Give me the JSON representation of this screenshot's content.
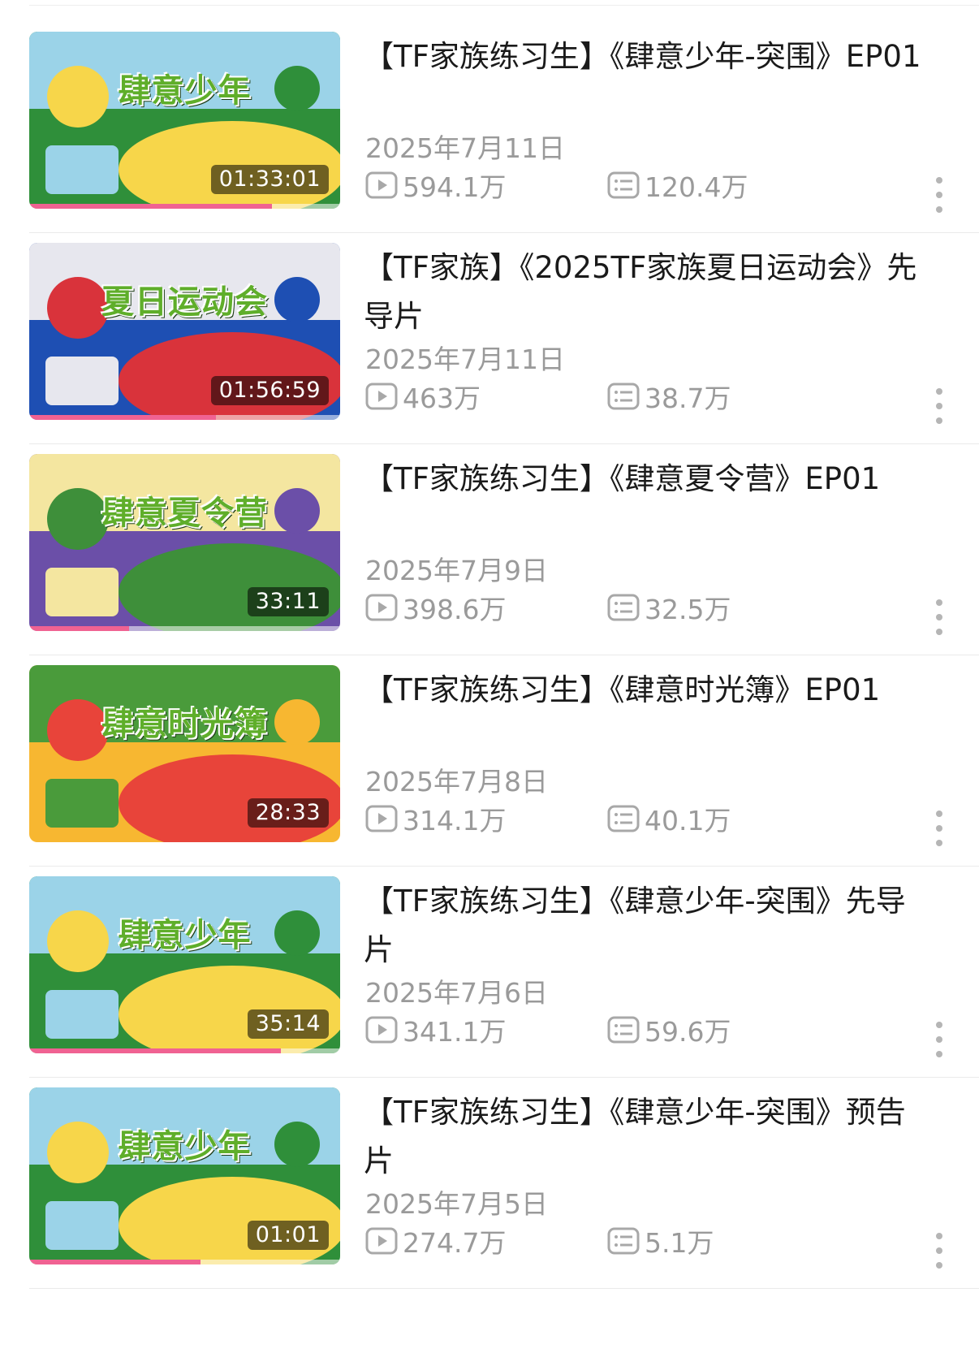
{
  "videos": [
    {
      "title": "【TF家族练习生】《肆意少年-突围》EP01",
      "date": "2025年7月11日",
      "duration": "01:33:01",
      "views": "594.1万",
      "comments": "120.4万",
      "watched": 0.78,
      "art_title": "肆意少年",
      "theme": [
        "#2f8f3a",
        "#9bd3e8",
        "#f7d64a"
      ]
    },
    {
      "title": "【TF家族】《2025TF家族夏日运动会》先导片",
      "date": "2025年7月11日",
      "duration": "01:56:59",
      "views": "463万",
      "comments": "38.7万",
      "watched": 0.6,
      "art_title": "夏日运动会",
      "theme": [
        "#1e4fb3",
        "#e7e7ee",
        "#d9333b"
      ]
    },
    {
      "title": "【TF家族练习生】《肆意夏令营》EP01",
      "date": "2025年7月9日",
      "duration": "33:11",
      "views": "398.6万",
      "comments": "32.5万",
      "watched": 0.32,
      "art_title": "肆意夏令营",
      "theme": [
        "#6b4fa8",
        "#f4e6a0",
        "#3e8f3a"
      ]
    },
    {
      "title": "【TF家族练习生】《肆意时光簿》EP01",
      "date": "2025年7月8日",
      "duration": "28:33",
      "views": "314.1万",
      "comments": "40.1万",
      "watched": 0.0,
      "art_title": "肆意时光簿",
      "theme": [
        "#f7b731",
        "#4a9b3b",
        "#e8443a"
      ]
    },
    {
      "title": "【TF家族练习生】《肆意少年-突围》先导片",
      "date": "2025年7月6日",
      "duration": "35:14",
      "views": "341.1万",
      "comments": "59.6万",
      "watched": 0.81,
      "art_title": "肆意少年",
      "theme": [
        "#2f8f3a",
        "#9bd3e8",
        "#f7d64a"
      ]
    },
    {
      "title": "【TF家族练习生】《肆意少年-突围》预告片",
      "date": "2025年7月5日",
      "duration": "01:01",
      "views": "274.7万",
      "comments": "5.1万",
      "watched": 0.55,
      "art_title": "肆意少年",
      "theme": [
        "#2f8f3a",
        "#9bd3e8",
        "#f7d64a"
      ]
    }
  ],
  "icons": {
    "views": "play-count-icon",
    "comments": "danmaku-icon",
    "more": "more-vertical-icon"
  }
}
